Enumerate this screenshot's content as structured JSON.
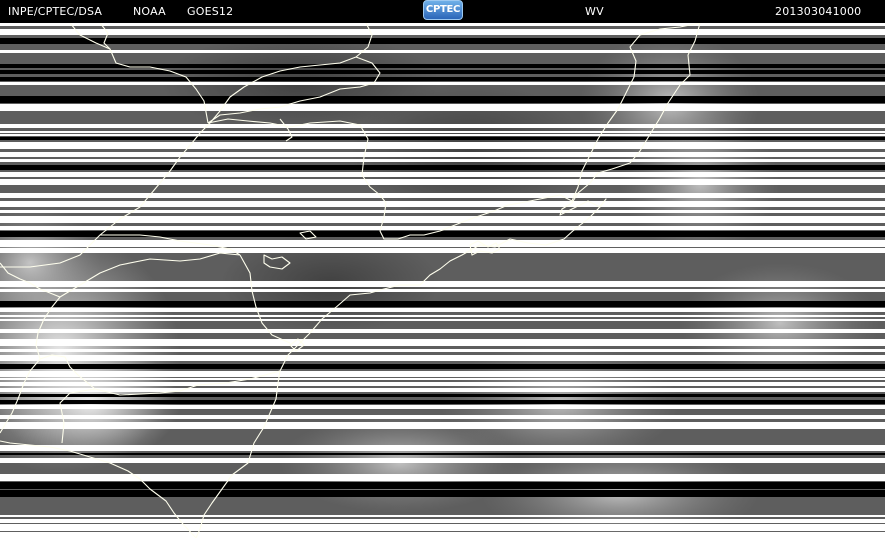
{
  "header": {
    "source": "INPE/CPTEC/DSA",
    "agency": "NOAA",
    "satellite": "GOES12",
    "logo_text": "CPTEC",
    "channel": "WV",
    "timestamp": "201303041000"
  },
  "colors": {
    "background": "#000000",
    "header_text": "#ffffff",
    "coastline": "#ffffee",
    "logo_blue": "#2b66b8"
  },
  "icons": {
    "logo": "cptec-logo"
  }
}
